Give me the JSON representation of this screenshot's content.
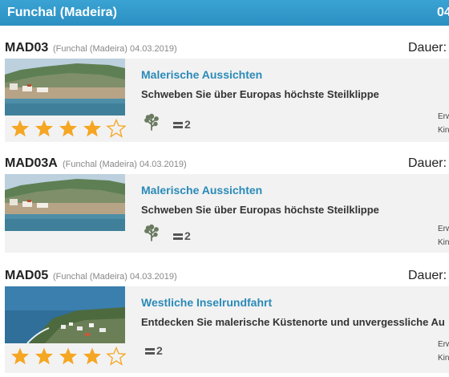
{
  "header": {
    "region": "Funchal (Madeira)",
    "right_cut": "04"
  },
  "colors": {
    "header": "#3aa3d3",
    "subtitle": "#2a8ab8",
    "star": "#f5a623",
    "panel": "#f2f2f2"
  },
  "tours": [
    {
      "code": "MAD03",
      "place_date": "(Funchal (Madeira) 04.03.2019)",
      "duration_label": "Dauer:",
      "title": "Malerische Aussichten",
      "description": "Schweben Sie über Europas höchste Steilklippe",
      "rating": 4,
      "rating_max": 5,
      "icons": [
        "tree-icon",
        "persons-icon"
      ],
      "persons": "2",
      "side_lines": [
        "Erw",
        "Kin"
      ]
    },
    {
      "code": "MAD03A",
      "place_date": "(Funchal (Madeira) 04.03.2019)",
      "duration_label": "Dauer:",
      "title": "Malerische Aussichten",
      "description": "Schweben Sie über Europas höchste Steilklippe",
      "rating": 0,
      "rating_max": 0,
      "icons": [
        "tree-icon",
        "persons-icon"
      ],
      "persons": "2",
      "side_lines": [
        "Erw",
        "Kin"
      ]
    },
    {
      "code": "MAD05",
      "place_date": "(Funchal (Madeira) 04.03.2019)",
      "duration_label": "Dauer:",
      "title": "Westliche Inselrundfahrt",
      "description": "Entdecken Sie malerische Küstenorte und unvergessliche Au",
      "rating": 4,
      "rating_max": 5,
      "icons": [
        "persons-icon"
      ],
      "persons": "2",
      "side_lines": [
        "Erw",
        "Kin"
      ]
    }
  ]
}
